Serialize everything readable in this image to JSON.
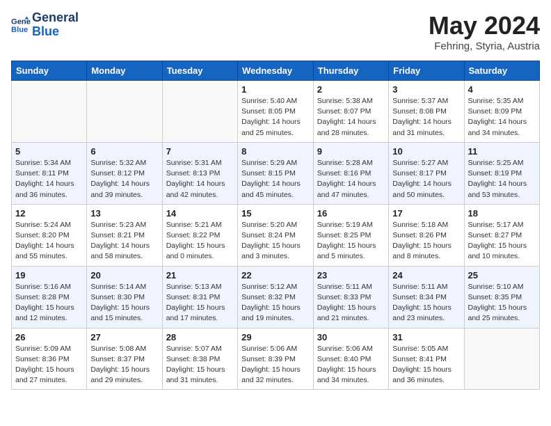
{
  "header": {
    "logo_line1": "General",
    "logo_line2": "Blue",
    "month": "May 2024",
    "location": "Fehring, Styria, Austria"
  },
  "weekdays": [
    "Sunday",
    "Monday",
    "Tuesday",
    "Wednesday",
    "Thursday",
    "Friday",
    "Saturday"
  ],
  "weeks": [
    [
      {
        "day": "",
        "info": ""
      },
      {
        "day": "",
        "info": ""
      },
      {
        "day": "",
        "info": ""
      },
      {
        "day": "1",
        "info": "Sunrise: 5:40 AM\nSunset: 8:05 PM\nDaylight: 14 hours\nand 25 minutes."
      },
      {
        "day": "2",
        "info": "Sunrise: 5:38 AM\nSunset: 8:07 PM\nDaylight: 14 hours\nand 28 minutes."
      },
      {
        "day": "3",
        "info": "Sunrise: 5:37 AM\nSunset: 8:08 PM\nDaylight: 14 hours\nand 31 minutes."
      },
      {
        "day": "4",
        "info": "Sunrise: 5:35 AM\nSunset: 8:09 PM\nDaylight: 14 hours\nand 34 minutes."
      }
    ],
    [
      {
        "day": "5",
        "info": "Sunrise: 5:34 AM\nSunset: 8:11 PM\nDaylight: 14 hours\nand 36 minutes."
      },
      {
        "day": "6",
        "info": "Sunrise: 5:32 AM\nSunset: 8:12 PM\nDaylight: 14 hours\nand 39 minutes."
      },
      {
        "day": "7",
        "info": "Sunrise: 5:31 AM\nSunset: 8:13 PM\nDaylight: 14 hours\nand 42 minutes."
      },
      {
        "day": "8",
        "info": "Sunrise: 5:29 AM\nSunset: 8:15 PM\nDaylight: 14 hours\nand 45 minutes."
      },
      {
        "day": "9",
        "info": "Sunrise: 5:28 AM\nSunset: 8:16 PM\nDaylight: 14 hours\nand 47 minutes."
      },
      {
        "day": "10",
        "info": "Sunrise: 5:27 AM\nSunset: 8:17 PM\nDaylight: 14 hours\nand 50 minutes."
      },
      {
        "day": "11",
        "info": "Sunrise: 5:25 AM\nSunset: 8:19 PM\nDaylight: 14 hours\nand 53 minutes."
      }
    ],
    [
      {
        "day": "12",
        "info": "Sunrise: 5:24 AM\nSunset: 8:20 PM\nDaylight: 14 hours\nand 55 minutes."
      },
      {
        "day": "13",
        "info": "Sunrise: 5:23 AM\nSunset: 8:21 PM\nDaylight: 14 hours\nand 58 minutes."
      },
      {
        "day": "14",
        "info": "Sunrise: 5:21 AM\nSunset: 8:22 PM\nDaylight: 15 hours\nand 0 minutes."
      },
      {
        "day": "15",
        "info": "Sunrise: 5:20 AM\nSunset: 8:24 PM\nDaylight: 15 hours\nand 3 minutes."
      },
      {
        "day": "16",
        "info": "Sunrise: 5:19 AM\nSunset: 8:25 PM\nDaylight: 15 hours\nand 5 minutes."
      },
      {
        "day": "17",
        "info": "Sunrise: 5:18 AM\nSunset: 8:26 PM\nDaylight: 15 hours\nand 8 minutes."
      },
      {
        "day": "18",
        "info": "Sunrise: 5:17 AM\nSunset: 8:27 PM\nDaylight: 15 hours\nand 10 minutes."
      }
    ],
    [
      {
        "day": "19",
        "info": "Sunrise: 5:16 AM\nSunset: 8:28 PM\nDaylight: 15 hours\nand 12 minutes."
      },
      {
        "day": "20",
        "info": "Sunrise: 5:14 AM\nSunset: 8:30 PM\nDaylight: 15 hours\nand 15 minutes."
      },
      {
        "day": "21",
        "info": "Sunrise: 5:13 AM\nSunset: 8:31 PM\nDaylight: 15 hours\nand 17 minutes."
      },
      {
        "day": "22",
        "info": "Sunrise: 5:12 AM\nSunset: 8:32 PM\nDaylight: 15 hours\nand 19 minutes."
      },
      {
        "day": "23",
        "info": "Sunrise: 5:11 AM\nSunset: 8:33 PM\nDaylight: 15 hours\nand 21 minutes."
      },
      {
        "day": "24",
        "info": "Sunrise: 5:11 AM\nSunset: 8:34 PM\nDaylight: 15 hours\nand 23 minutes."
      },
      {
        "day": "25",
        "info": "Sunrise: 5:10 AM\nSunset: 8:35 PM\nDaylight: 15 hours\nand 25 minutes."
      }
    ],
    [
      {
        "day": "26",
        "info": "Sunrise: 5:09 AM\nSunset: 8:36 PM\nDaylight: 15 hours\nand 27 minutes."
      },
      {
        "day": "27",
        "info": "Sunrise: 5:08 AM\nSunset: 8:37 PM\nDaylight: 15 hours\nand 29 minutes."
      },
      {
        "day": "28",
        "info": "Sunrise: 5:07 AM\nSunset: 8:38 PM\nDaylight: 15 hours\nand 31 minutes."
      },
      {
        "day": "29",
        "info": "Sunrise: 5:06 AM\nSunset: 8:39 PM\nDaylight: 15 hours\nand 32 minutes."
      },
      {
        "day": "30",
        "info": "Sunrise: 5:06 AM\nSunset: 8:40 PM\nDaylight: 15 hours\nand 34 minutes."
      },
      {
        "day": "31",
        "info": "Sunrise: 5:05 AM\nSunset: 8:41 PM\nDaylight: 15 hours\nand 36 minutes."
      },
      {
        "day": "",
        "info": ""
      }
    ]
  ]
}
